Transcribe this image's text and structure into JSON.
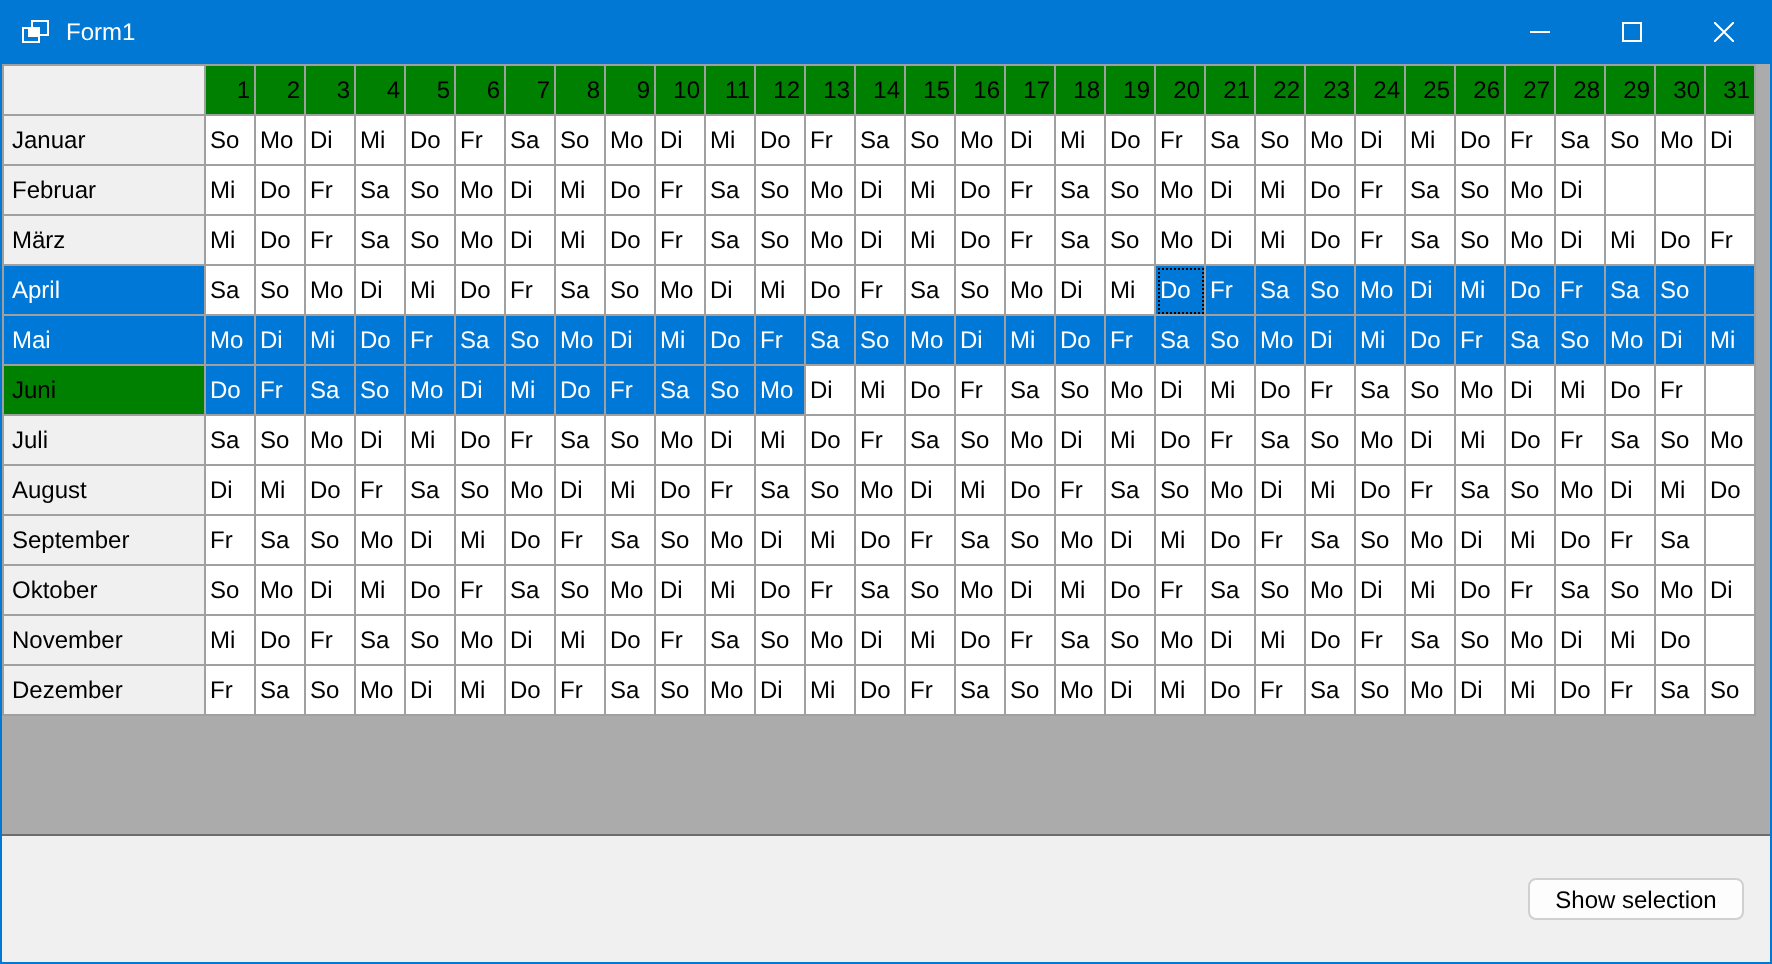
{
  "window": {
    "title": "Form1"
  },
  "columns": [
    "1",
    "2",
    "3",
    "4",
    "5",
    "6",
    "7",
    "8",
    "9",
    "10",
    "11",
    "12",
    "13",
    "14",
    "15",
    "16",
    "17",
    "18",
    "19",
    "20",
    "21",
    "22",
    "23",
    "24",
    "25",
    "26",
    "27",
    "28",
    "29",
    "30",
    "31"
  ],
  "rows": [
    {
      "month": "Januar",
      "selected": false,
      "current": false,
      "cells": [
        {
          "text": "So",
          "selected": false,
          "focused": false
        },
        {
          "text": "Mo",
          "selected": false,
          "focused": false
        },
        {
          "text": "Di",
          "selected": false,
          "focused": false
        },
        {
          "text": "Mi",
          "selected": false,
          "focused": false
        },
        {
          "text": "Do",
          "selected": false,
          "focused": false
        },
        {
          "text": "Fr",
          "selected": false,
          "focused": false
        },
        {
          "text": "Sa",
          "selected": false,
          "focused": false
        },
        {
          "text": "So",
          "selected": false,
          "focused": false
        },
        {
          "text": "Mo",
          "selected": false,
          "focused": false
        },
        {
          "text": "Di",
          "selected": false,
          "focused": false
        },
        {
          "text": "Mi",
          "selected": false,
          "focused": false
        },
        {
          "text": "Do",
          "selected": false,
          "focused": false
        },
        {
          "text": "Fr",
          "selected": false,
          "focused": false
        },
        {
          "text": "Sa",
          "selected": false,
          "focused": false
        },
        {
          "text": "So",
          "selected": false,
          "focused": false
        },
        {
          "text": "Mo",
          "selected": false,
          "focused": false
        },
        {
          "text": "Di",
          "selected": false,
          "focused": false
        },
        {
          "text": "Mi",
          "selected": false,
          "focused": false
        },
        {
          "text": "Do",
          "selected": false,
          "focused": false
        },
        {
          "text": "Fr",
          "selected": false,
          "focused": false
        },
        {
          "text": "Sa",
          "selected": false,
          "focused": false
        },
        {
          "text": "So",
          "selected": false,
          "focused": false
        },
        {
          "text": "Mo",
          "selected": false,
          "focused": false
        },
        {
          "text": "Di",
          "selected": false,
          "focused": false
        },
        {
          "text": "Mi",
          "selected": false,
          "focused": false
        },
        {
          "text": "Do",
          "selected": false,
          "focused": false
        },
        {
          "text": "Fr",
          "selected": false,
          "focused": false
        },
        {
          "text": "Sa",
          "selected": false,
          "focused": false
        },
        {
          "text": "So",
          "selected": false,
          "focused": false
        },
        {
          "text": "Mo",
          "selected": false,
          "focused": false
        },
        {
          "text": "Di",
          "selected": false,
          "focused": false
        }
      ]
    },
    {
      "month": "Februar",
      "selected": false,
      "current": false,
      "cells": [
        {
          "text": "Mi",
          "selected": false,
          "focused": false
        },
        {
          "text": "Do",
          "selected": false,
          "focused": false
        },
        {
          "text": "Fr",
          "selected": false,
          "focused": false
        },
        {
          "text": "Sa",
          "selected": false,
          "focused": false
        },
        {
          "text": "So",
          "selected": false,
          "focused": false
        },
        {
          "text": "Mo",
          "selected": false,
          "focused": false
        },
        {
          "text": "Di",
          "selected": false,
          "focused": false
        },
        {
          "text": "Mi",
          "selected": false,
          "focused": false
        },
        {
          "text": "Do",
          "selected": false,
          "focused": false
        },
        {
          "text": "Fr",
          "selected": false,
          "focused": false
        },
        {
          "text": "Sa",
          "selected": false,
          "focused": false
        },
        {
          "text": "So",
          "selected": false,
          "focused": false
        },
        {
          "text": "Mo",
          "selected": false,
          "focused": false
        },
        {
          "text": "Di",
          "selected": false,
          "focused": false
        },
        {
          "text": "Mi",
          "selected": false,
          "focused": false
        },
        {
          "text": "Do",
          "selected": false,
          "focused": false
        },
        {
          "text": "Fr",
          "selected": false,
          "focused": false
        },
        {
          "text": "Sa",
          "selected": false,
          "focused": false
        },
        {
          "text": "So",
          "selected": false,
          "focused": false
        },
        {
          "text": "Mo",
          "selected": false,
          "focused": false
        },
        {
          "text": "Di",
          "selected": false,
          "focused": false
        },
        {
          "text": "Mi",
          "selected": false,
          "focused": false
        },
        {
          "text": "Do",
          "selected": false,
          "focused": false
        },
        {
          "text": "Fr",
          "selected": false,
          "focused": false
        },
        {
          "text": "Sa",
          "selected": false,
          "focused": false
        },
        {
          "text": "So",
          "selected": false,
          "focused": false
        },
        {
          "text": "Mo",
          "selected": false,
          "focused": false
        },
        {
          "text": "Di",
          "selected": false,
          "focused": false
        },
        {
          "selected": false,
          "focused": false
        },
        {
          "selected": false,
          "focused": false
        },
        {
          "selected": false,
          "focused": false
        }
      ]
    },
    {
      "month": "März",
      "selected": false,
      "current": false,
      "cells": [
        {
          "text": "Mi",
          "selected": false,
          "focused": false
        },
        {
          "text": "Do",
          "selected": false,
          "focused": false
        },
        {
          "text": "Fr",
          "selected": false,
          "focused": false
        },
        {
          "text": "Sa",
          "selected": false,
          "focused": false
        },
        {
          "text": "So",
          "selected": false,
          "focused": false
        },
        {
          "text": "Mo",
          "selected": false,
          "focused": false
        },
        {
          "text": "Di",
          "selected": false,
          "focused": false
        },
        {
          "text": "Mi",
          "selected": false,
          "focused": false
        },
        {
          "text": "Do",
          "selected": false,
          "focused": false
        },
        {
          "text": "Fr",
          "selected": false,
          "focused": false
        },
        {
          "text": "Sa",
          "selected": false,
          "focused": false
        },
        {
          "text": "So",
          "selected": false,
          "focused": false
        },
        {
          "text": "Mo",
          "selected": false,
          "focused": false
        },
        {
          "text": "Di",
          "selected": false,
          "focused": false
        },
        {
          "text": "Mi",
          "selected": false,
          "focused": false
        },
        {
          "text": "Do",
          "selected": false,
          "focused": false
        },
        {
          "text": "Fr",
          "selected": false,
          "focused": false
        },
        {
          "text": "Sa",
          "selected": false,
          "focused": false
        },
        {
          "text": "So",
          "selected": false,
          "focused": false
        },
        {
          "text": "Mo",
          "selected": false,
          "focused": false
        },
        {
          "text": "Di",
          "selected": false,
          "focused": false
        },
        {
          "text": "Mi",
          "selected": false,
          "focused": false
        },
        {
          "text": "Do",
          "selected": false,
          "focused": false
        },
        {
          "text": "Fr",
          "selected": false,
          "focused": false
        },
        {
          "text": "Sa",
          "selected": false,
          "focused": false
        },
        {
          "text": "So",
          "selected": false,
          "focused": false
        },
        {
          "text": "Mo",
          "selected": false,
          "focused": false
        },
        {
          "text": "Di",
          "selected": false,
          "focused": false
        },
        {
          "text": "Mi",
          "selected": false,
          "focused": false
        },
        {
          "text": "Do",
          "selected": false,
          "focused": false
        },
        {
          "text": "Fr",
          "selected": false,
          "focused": false
        }
      ]
    },
    {
      "month": "April",
      "selected": true,
      "current": false,
      "cells": [
        {
          "text": "Sa",
          "selected": false,
          "focused": false
        },
        {
          "text": "So",
          "selected": false,
          "focused": false
        },
        {
          "text": "Mo",
          "selected": false,
          "focused": false
        },
        {
          "text": "Di",
          "selected": false,
          "focused": false
        },
        {
          "text": "Mi",
          "selected": false,
          "focused": false
        },
        {
          "text": "Do",
          "selected": false,
          "focused": false
        },
        {
          "text": "Fr",
          "selected": false,
          "focused": false
        },
        {
          "text": "Sa",
          "selected": false,
          "focused": false
        },
        {
          "text": "So",
          "selected": false,
          "focused": false
        },
        {
          "text": "Mo",
          "selected": false,
          "focused": false
        },
        {
          "text": "Di",
          "selected": false,
          "focused": false
        },
        {
          "text": "Mi",
          "selected": false,
          "focused": false
        },
        {
          "text": "Do",
          "selected": false,
          "focused": false
        },
        {
          "text": "Fr",
          "selected": false,
          "focused": false
        },
        {
          "text": "Sa",
          "selected": false,
          "focused": false
        },
        {
          "text": "So",
          "selected": false,
          "focused": false
        },
        {
          "text": "Mo",
          "selected": false,
          "focused": false
        },
        {
          "text": "Di",
          "selected": false,
          "focused": false
        },
        {
          "text": "Mi",
          "selected": false,
          "focused": false
        },
        {
          "text": "Do",
          "selected": true,
          "focused": true
        },
        {
          "text": "Fr",
          "selected": true,
          "focused": false
        },
        {
          "text": "Sa",
          "selected": true,
          "focused": false
        },
        {
          "text": "So",
          "selected": true,
          "focused": false
        },
        {
          "text": "Mo",
          "selected": true,
          "focused": false
        },
        {
          "text": "Di",
          "selected": true,
          "focused": false
        },
        {
          "text": "Mi",
          "selected": true,
          "focused": false
        },
        {
          "text": "Do",
          "selected": true,
          "focused": false
        },
        {
          "text": "Fr",
          "selected": true,
          "focused": false
        },
        {
          "text": "Sa",
          "selected": true,
          "focused": false
        },
        {
          "text": "So",
          "selected": true,
          "focused": false
        },
        {
          "selected": true,
          "focused": false
        }
      ]
    },
    {
      "month": "Mai",
      "selected": true,
      "current": false,
      "cells": [
        {
          "text": "Mo",
          "selected": true,
          "focused": false
        },
        {
          "text": "Di",
          "selected": true,
          "focused": false
        },
        {
          "text": "Mi",
          "selected": true,
          "focused": false
        },
        {
          "text": "Do",
          "selected": true,
          "focused": false
        },
        {
          "text": "Fr",
          "selected": true,
          "focused": false
        },
        {
          "text": "Sa",
          "selected": true,
          "focused": false
        },
        {
          "text": "So",
          "selected": true,
          "focused": false
        },
        {
          "text": "Mo",
          "selected": true,
          "focused": false
        },
        {
          "text": "Di",
          "selected": true,
          "focused": false
        },
        {
          "text": "Mi",
          "selected": true,
          "focused": false
        },
        {
          "text": "Do",
          "selected": true,
          "focused": false
        },
        {
          "text": "Fr",
          "selected": true,
          "focused": false
        },
        {
          "text": "Sa",
          "selected": true,
          "focused": false
        },
        {
          "text": "So",
          "selected": true,
          "focused": false
        },
        {
          "text": "Mo",
          "selected": true,
          "focused": false
        },
        {
          "text": "Di",
          "selected": true,
          "focused": false
        },
        {
          "text": "Mi",
          "selected": true,
          "focused": false
        },
        {
          "text": "Do",
          "selected": true,
          "focused": false
        },
        {
          "text": "Fr",
          "selected": true,
          "focused": false
        },
        {
          "text": "Sa",
          "selected": true,
          "focused": false
        },
        {
          "text": "So",
          "selected": true,
          "focused": false
        },
        {
          "text": "Mo",
          "selected": true,
          "focused": false
        },
        {
          "text": "Di",
          "selected": true,
          "focused": false
        },
        {
          "text": "Mi",
          "selected": true,
          "focused": false
        },
        {
          "text": "Do",
          "selected": true,
          "focused": false
        },
        {
          "text": "Fr",
          "selected": true,
          "focused": false
        },
        {
          "text": "Sa",
          "selected": true,
          "focused": false
        },
        {
          "text": "So",
          "selected": true,
          "focused": false
        },
        {
          "text": "Mo",
          "selected": true,
          "focused": false
        },
        {
          "text": "Di",
          "selected": true,
          "focused": false
        },
        {
          "text": "Mi",
          "selected": true,
          "focused": false
        }
      ]
    },
    {
      "month": "Juni",
      "selected": false,
      "current": true,
      "cells": [
        {
          "text": "Do",
          "selected": true,
          "focused": false
        },
        {
          "text": "Fr",
          "selected": true,
          "focused": false
        },
        {
          "text": "Sa",
          "selected": true,
          "focused": false
        },
        {
          "text": "So",
          "selected": true,
          "focused": false
        },
        {
          "text": "Mo",
          "selected": true,
          "focused": false
        },
        {
          "text": "Di",
          "selected": true,
          "focused": false
        },
        {
          "text": "Mi",
          "selected": true,
          "focused": false
        },
        {
          "text": "Do",
          "selected": true,
          "focused": false
        },
        {
          "text": "Fr",
          "selected": true,
          "focused": false
        },
        {
          "text": "Sa",
          "selected": true,
          "focused": false
        },
        {
          "text": "So",
          "selected": true,
          "focused": false
        },
        {
          "text": "Mo",
          "selected": true,
          "focused": false
        },
        {
          "text": "Di",
          "selected": false,
          "focused": false
        },
        {
          "text": "Mi",
          "selected": false,
          "focused": false
        },
        {
          "text": "Do",
          "selected": false,
          "focused": false
        },
        {
          "text": "Fr",
          "selected": false,
          "focused": false
        },
        {
          "text": "Sa",
          "selected": false,
          "focused": false
        },
        {
          "text": "So",
          "selected": false,
          "focused": false
        },
        {
          "text": "Mo",
          "selected": false,
          "focused": false
        },
        {
          "text": "Di",
          "selected": false,
          "focused": false
        },
        {
          "text": "Mi",
          "selected": false,
          "focused": false
        },
        {
          "text": "Do",
          "selected": false,
          "focused": false
        },
        {
          "text": "Fr",
          "selected": false,
          "focused": false
        },
        {
          "text": "Sa",
          "selected": false,
          "focused": false
        },
        {
          "text": "So",
          "selected": false,
          "focused": false
        },
        {
          "text": "Mo",
          "selected": false,
          "focused": false
        },
        {
          "text": "Di",
          "selected": false,
          "focused": false
        },
        {
          "text": "Mi",
          "selected": false,
          "focused": false
        },
        {
          "text": "Do",
          "selected": false,
          "focused": false
        },
        {
          "text": "Fr",
          "selected": false,
          "focused": false
        },
        {
          "selected": false,
          "focused": false
        }
      ]
    },
    {
      "month": "Juli",
      "selected": false,
      "current": false,
      "cells": [
        {
          "text": "Sa",
          "selected": false,
          "focused": false
        },
        {
          "text": "So",
          "selected": false,
          "focused": false
        },
        {
          "text": "Mo",
          "selected": false,
          "focused": false
        },
        {
          "text": "Di",
          "selected": false,
          "focused": false
        },
        {
          "text": "Mi",
          "selected": false,
          "focused": false
        },
        {
          "text": "Do",
          "selected": false,
          "focused": false
        },
        {
          "text": "Fr",
          "selected": false,
          "focused": false
        },
        {
          "text": "Sa",
          "selected": false,
          "focused": false
        },
        {
          "text": "So",
          "selected": false,
          "focused": false
        },
        {
          "text": "Mo",
          "selected": false,
          "focused": false
        },
        {
          "text": "Di",
          "selected": false,
          "focused": false
        },
        {
          "text": "Mi",
          "selected": false,
          "focused": false
        },
        {
          "text": "Do",
          "selected": false,
          "focused": false
        },
        {
          "text": "Fr",
          "selected": false,
          "focused": false
        },
        {
          "text": "Sa",
          "selected": false,
          "focused": false
        },
        {
          "text": "So",
          "selected": false,
          "focused": false
        },
        {
          "text": "Mo",
          "selected": false,
          "focused": false
        },
        {
          "text": "Di",
          "selected": false,
          "focused": false
        },
        {
          "text": "Mi",
          "selected": false,
          "focused": false
        },
        {
          "text": "Do",
          "selected": false,
          "focused": false
        },
        {
          "text": "Fr",
          "selected": false,
          "focused": false
        },
        {
          "text": "Sa",
          "selected": false,
          "focused": false
        },
        {
          "text": "So",
          "selected": false,
          "focused": false
        },
        {
          "text": "Mo",
          "selected": false,
          "focused": false
        },
        {
          "text": "Di",
          "selected": false,
          "focused": false
        },
        {
          "text": "Mi",
          "selected": false,
          "focused": false
        },
        {
          "text": "Do",
          "selected": false,
          "focused": false
        },
        {
          "text": "Fr",
          "selected": false,
          "focused": false
        },
        {
          "text": "Sa",
          "selected": false,
          "focused": false
        },
        {
          "text": "So",
          "selected": false,
          "focused": false
        },
        {
          "text": "Mo",
          "selected": false,
          "focused": false
        }
      ]
    },
    {
      "month": "August",
      "selected": false,
      "current": false,
      "cells": [
        {
          "text": "Di",
          "selected": false,
          "focused": false
        },
        {
          "text": "Mi",
          "selected": false,
          "focused": false
        },
        {
          "text": "Do",
          "selected": false,
          "focused": false
        },
        {
          "text": "Fr",
          "selected": false,
          "focused": false
        },
        {
          "text": "Sa",
          "selected": false,
          "focused": false
        },
        {
          "text": "So",
          "selected": false,
          "focused": false
        },
        {
          "text": "Mo",
          "selected": false,
          "focused": false
        },
        {
          "text": "Di",
          "selected": false,
          "focused": false
        },
        {
          "text": "Mi",
          "selected": false,
          "focused": false
        },
        {
          "text": "Do",
          "selected": false,
          "focused": false
        },
        {
          "text": "Fr",
          "selected": false,
          "focused": false
        },
        {
          "text": "Sa",
          "selected": false,
          "focused": false
        },
        {
          "text": "So",
          "selected": false,
          "focused": false
        },
        {
          "text": "Mo",
          "selected": false,
          "focused": false
        },
        {
          "text": "Di",
          "selected": false,
          "focused": false
        },
        {
          "text": "Mi",
          "selected": false,
          "focused": false
        },
        {
          "text": "Do",
          "selected": false,
          "focused": false
        },
        {
          "text": "Fr",
          "selected": false,
          "focused": false
        },
        {
          "text": "Sa",
          "selected": false,
          "focused": false
        },
        {
          "text": "So",
          "selected": false,
          "focused": false
        },
        {
          "text": "Mo",
          "selected": false,
          "focused": false
        },
        {
          "text": "Di",
          "selected": false,
          "focused": false
        },
        {
          "text": "Mi",
          "selected": false,
          "focused": false
        },
        {
          "text": "Do",
          "selected": false,
          "focused": false
        },
        {
          "text": "Fr",
          "selected": false,
          "focused": false
        },
        {
          "text": "Sa",
          "selected": false,
          "focused": false
        },
        {
          "text": "So",
          "selected": false,
          "focused": false
        },
        {
          "text": "Mo",
          "selected": false,
          "focused": false
        },
        {
          "text": "Di",
          "selected": false,
          "focused": false
        },
        {
          "text": "Mi",
          "selected": false,
          "focused": false
        },
        {
          "text": "Do",
          "selected": false,
          "focused": false
        }
      ]
    },
    {
      "month": "September",
      "selected": false,
      "current": false,
      "cells": [
        {
          "text": "Fr",
          "selected": false,
          "focused": false
        },
        {
          "text": "Sa",
          "selected": false,
          "focused": false
        },
        {
          "text": "So",
          "selected": false,
          "focused": false
        },
        {
          "text": "Mo",
          "selected": false,
          "focused": false
        },
        {
          "text": "Di",
          "selected": false,
          "focused": false
        },
        {
          "text": "Mi",
          "selected": false,
          "focused": false
        },
        {
          "text": "Do",
          "selected": false,
          "focused": false
        },
        {
          "text": "Fr",
          "selected": false,
          "focused": false
        },
        {
          "text": "Sa",
          "selected": false,
          "focused": false
        },
        {
          "text": "So",
          "selected": false,
          "focused": false
        },
        {
          "text": "Mo",
          "selected": false,
          "focused": false
        },
        {
          "text": "Di",
          "selected": false,
          "focused": false
        },
        {
          "text": "Mi",
          "selected": false,
          "focused": false
        },
        {
          "text": "Do",
          "selected": false,
          "focused": false
        },
        {
          "text": "Fr",
          "selected": false,
          "focused": false
        },
        {
          "text": "Sa",
          "selected": false,
          "focused": false
        },
        {
          "text": "So",
          "selected": false,
          "focused": false
        },
        {
          "text": "Mo",
          "selected": false,
          "focused": false
        },
        {
          "text": "Di",
          "selected": false,
          "focused": false
        },
        {
          "text": "Mi",
          "selected": false,
          "focused": false
        },
        {
          "text": "Do",
          "selected": false,
          "focused": false
        },
        {
          "text": "Fr",
          "selected": false,
          "focused": false
        },
        {
          "text": "Sa",
          "selected": false,
          "focused": false
        },
        {
          "text": "So",
          "selected": false,
          "focused": false
        },
        {
          "text": "Mo",
          "selected": false,
          "focused": false
        },
        {
          "text": "Di",
          "selected": false,
          "focused": false
        },
        {
          "text": "Mi",
          "selected": false,
          "focused": false
        },
        {
          "text": "Do",
          "selected": false,
          "focused": false
        },
        {
          "text": "Fr",
          "selected": false,
          "focused": false
        },
        {
          "text": "Sa",
          "selected": false,
          "focused": false
        },
        {
          "selected": false,
          "focused": false
        }
      ]
    },
    {
      "month": "Oktober",
      "selected": false,
      "current": false,
      "cells": [
        {
          "text": "So",
          "selected": false,
          "focused": false
        },
        {
          "text": "Mo",
          "selected": false,
          "focused": false
        },
        {
          "text": "Di",
          "selected": false,
          "focused": false
        },
        {
          "text": "Mi",
          "selected": false,
          "focused": false
        },
        {
          "text": "Do",
          "selected": false,
          "focused": false
        },
        {
          "text": "Fr",
          "selected": false,
          "focused": false
        },
        {
          "text": "Sa",
          "selected": false,
          "focused": false
        },
        {
          "text": "So",
          "selected": false,
          "focused": false
        },
        {
          "text": "Mo",
          "selected": false,
          "focused": false
        },
        {
          "text": "Di",
          "selected": false,
          "focused": false
        },
        {
          "text": "Mi",
          "selected": false,
          "focused": false
        },
        {
          "text": "Do",
          "selected": false,
          "focused": false
        },
        {
          "text": "Fr",
          "selected": false,
          "focused": false
        },
        {
          "text": "Sa",
          "selected": false,
          "focused": false
        },
        {
          "text": "So",
          "selected": false,
          "focused": false
        },
        {
          "text": "Mo",
          "selected": false,
          "focused": false
        },
        {
          "text": "Di",
          "selected": false,
          "focused": false
        },
        {
          "text": "Mi",
          "selected": false,
          "focused": false
        },
        {
          "text": "Do",
          "selected": false,
          "focused": false
        },
        {
          "text": "Fr",
          "selected": false,
          "focused": false
        },
        {
          "text": "Sa",
          "selected": false,
          "focused": false
        },
        {
          "text": "So",
          "selected": false,
          "focused": false
        },
        {
          "text": "Mo",
          "selected": false,
          "focused": false
        },
        {
          "text": "Di",
          "selected": false,
          "focused": false
        },
        {
          "text": "Mi",
          "selected": false,
          "focused": false
        },
        {
          "text": "Do",
          "selected": false,
          "focused": false
        },
        {
          "text": "Fr",
          "selected": false,
          "focused": false
        },
        {
          "text": "Sa",
          "selected": false,
          "focused": false
        },
        {
          "text": "So",
          "selected": false,
          "focused": false
        },
        {
          "text": "Mo",
          "selected": false,
          "focused": false
        },
        {
          "text": "Di",
          "selected": false,
          "focused": false
        }
      ]
    },
    {
      "month": "November",
      "selected": false,
      "current": false,
      "cells": [
        {
          "text": "Mi",
          "selected": false,
          "focused": false
        },
        {
          "text": "Do",
          "selected": false,
          "focused": false
        },
        {
          "text": "Fr",
          "selected": false,
          "focused": false
        },
        {
          "text": "Sa",
          "selected": false,
          "focused": false
        },
        {
          "text": "So",
          "selected": false,
          "focused": false
        },
        {
          "text": "Mo",
          "selected": false,
          "focused": false
        },
        {
          "text": "Di",
          "selected": false,
          "focused": false
        },
        {
          "text": "Mi",
          "selected": false,
          "focused": false
        },
        {
          "text": "Do",
          "selected": false,
          "focused": false
        },
        {
          "text": "Fr",
          "selected": false,
          "focused": false
        },
        {
          "text": "Sa",
          "selected": false,
          "focused": false
        },
        {
          "text": "So",
          "selected": false,
          "focused": false
        },
        {
          "text": "Mo",
          "selected": false,
          "focused": false
        },
        {
          "text": "Di",
          "selected": false,
          "focused": false
        },
        {
          "text": "Mi",
          "selected": false,
          "focused": false
        },
        {
          "text": "Do",
          "selected": false,
          "focused": false
        },
        {
          "text": "Fr",
          "selected": false,
          "focused": false
        },
        {
          "text": "Sa",
          "selected": false,
          "focused": false
        },
        {
          "text": "So",
          "selected": false,
          "focused": false
        },
        {
          "text": "Mo",
          "selected": false,
          "focused": false
        },
        {
          "text": "Di",
          "selected": false,
          "focused": false
        },
        {
          "text": "Mi",
          "selected": false,
          "focused": false
        },
        {
          "text": "Do",
          "selected": false,
          "focused": false
        },
        {
          "text": "Fr",
          "selected": false,
          "focused": false
        },
        {
          "text": "Sa",
          "selected": false,
          "focused": false
        },
        {
          "text": "So",
          "selected": false,
          "focused": false
        },
        {
          "text": "Mo",
          "selected": false,
          "focused": false
        },
        {
          "text": "Di",
          "selected": false,
          "focused": false
        },
        {
          "text": "Mi",
          "selected": false,
          "focused": false
        },
        {
          "text": "Do",
          "selected": false,
          "focused": false
        },
        {
          "selected": false,
          "focused": false
        }
      ]
    },
    {
      "month": "Dezember",
      "selected": false,
      "current": false,
      "cells": [
        {
          "text": "Fr",
          "selected": false,
          "focused": false
        },
        {
          "text": "Sa",
          "selected": false,
          "focused": false
        },
        {
          "text": "So",
          "selected": false,
          "focused": false
        },
        {
          "text": "Mo",
          "selected": false,
          "focused": false
        },
        {
          "text": "Di",
          "selected": false,
          "focused": false
        },
        {
          "text": "Mi",
          "selected": false,
          "focused": false
        },
        {
          "text": "Do",
          "selected": false,
          "focused": false
        },
        {
          "text": "Fr",
          "selected": false,
          "focused": false
        },
        {
          "text": "Sa",
          "selected": false,
          "focused": false
        },
        {
          "text": "So",
          "selected": false,
          "focused": false
        },
        {
          "text": "Mo",
          "selected": false,
          "focused": false
        },
        {
          "text": "Di",
          "selected": false,
          "focused": false
        },
        {
          "text": "Mi",
          "selected": false,
          "focused": false
        },
        {
          "text": "Do",
          "selected": false,
          "focused": false
        },
        {
          "text": "Fr",
          "selected": false,
          "focused": false
        },
        {
          "text": "Sa",
          "selected": false,
          "focused": false
        },
        {
          "text": "So",
          "selected": false,
          "focused": false
        },
        {
          "text": "Mo",
          "selected": false,
          "focused": false
        },
        {
          "text": "Di",
          "selected": false,
          "focused": false
        },
        {
          "text": "Mi",
          "selected": false,
          "focused": false
        },
        {
          "text": "Do",
          "selected": false,
          "focused": false
        },
        {
          "text": "Fr",
          "selected": false,
          "focused": false
        },
        {
          "text": "Sa",
          "selected": false,
          "focused": false
        },
        {
          "text": "So",
          "selected": false,
          "focused": false
        },
        {
          "text": "Mo",
          "selected": false,
          "focused": false
        },
        {
          "text": "Di",
          "selected": false,
          "focused": false
        },
        {
          "text": "Mi",
          "selected": false,
          "focused": false
        },
        {
          "text": "Do",
          "selected": false,
          "focused": false
        },
        {
          "text": "Fr",
          "selected": false,
          "focused": false
        },
        {
          "text": "Sa",
          "selected": false,
          "focused": false
        },
        {
          "text": "So",
          "selected": false,
          "focused": false
        }
      ]
    }
  ],
  "buttons": [
    "Show selection"
  ]
}
